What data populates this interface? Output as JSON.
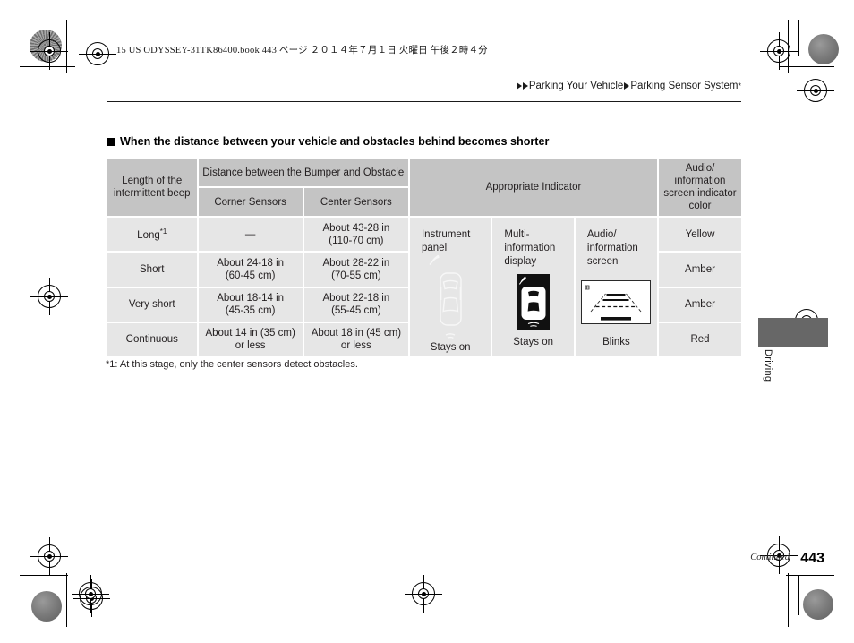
{
  "page": {
    "print_header": "15 US ODYSSEY-31TK86400.book   443 ページ   ２０１４年７月１日   火曜日   午後２時４分",
    "breadcrumb_1": "Parking Your Vehicle",
    "breadcrumb_2": "Parking Sensor System",
    "breadcrumb_2_mark": "*",
    "section_heading": "When the distance between your vehicle and obstacles behind becomes shorter",
    "footnote": "*1: At this stage, only the center sensors detect obstacles.",
    "continued_label": "Continued",
    "page_number": "443",
    "side_tab_label": "Driving"
  },
  "table": {
    "headers": {
      "beep_length": "Length of the intermittent beep",
      "distance_group": "Distance between the Bumper and Obstacle",
      "corner_sensors": "Corner Sensors",
      "center_sensors": "Center Sensors",
      "appropriate_indicator": "Appropriate Indicator",
      "indicator_color": "Audio/ information screen indicator color"
    },
    "rows": [
      {
        "beep": "Long",
        "beep_sup": "*1",
        "corner": "—",
        "corner_sub": "",
        "center": "About 43-28 in",
        "center_sub": "(110-70 cm)",
        "color": "Yellow"
      },
      {
        "beep": "Short",
        "beep_sup": "",
        "corner": "About 24-18 in",
        "corner_sub": "(60-45 cm)",
        "center": "About 28-22 in",
        "center_sub": "(70-55 cm)",
        "color": "Amber"
      },
      {
        "beep": "Very short",
        "beep_sup": "",
        "corner": "About 18-14 in",
        "corner_sub": "(45-35 cm)",
        "center": "About 22-18 in",
        "center_sub": "(55-45 cm)",
        "color": "Amber"
      },
      {
        "beep": "Continuous",
        "beep_sup": "",
        "corner": "About 14 in (35 cm)",
        "corner_sub": "or less",
        "center": "About 18 in (45 cm)",
        "center_sub": "or less",
        "color": "Red"
      }
    ],
    "indicators": [
      {
        "label": "Instrument panel",
        "status": "Stays on",
        "art": "car-top-view-faint-icon"
      },
      {
        "label": "Multi- information display",
        "status": "Stays on",
        "art": "car-top-view-display-icon"
      },
      {
        "label": "Audio/ information screen",
        "status": "Blinks",
        "art": "rear-camera-guideline-icon"
      }
    ]
  },
  "colors": {
    "header_cell": "#c4c4c4",
    "body_cell": "#e6e6e6",
    "page_background": "#ffffff",
    "tab_block": "#676767",
    "display_tile": "#111111"
  }
}
